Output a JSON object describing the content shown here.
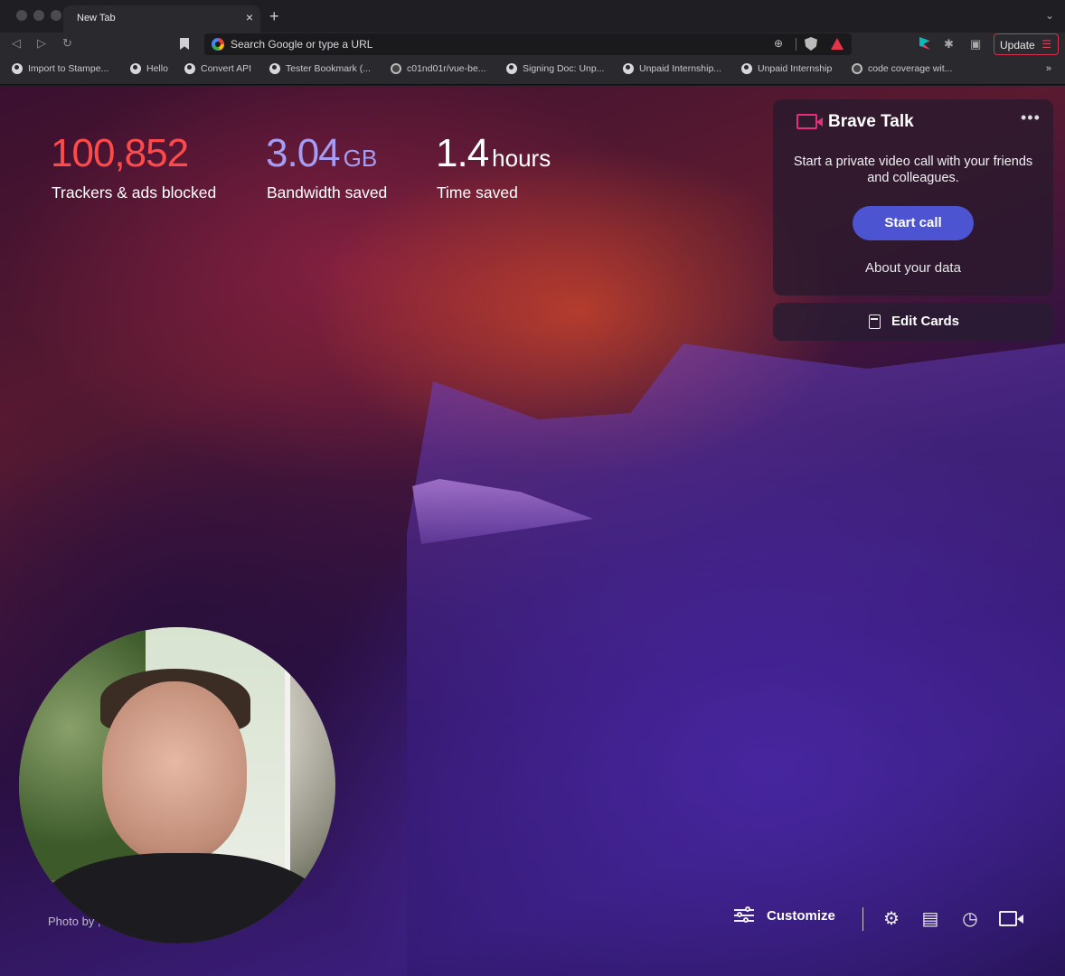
{
  "browser": {
    "tab_title": "New Tab",
    "tab_close": "×",
    "new_tab": "+",
    "tab_menu": "⌄",
    "url_placeholder": "Search Google or type a URL",
    "update_label": "Update",
    "bookmarks": [
      {
        "label": "Import to Stampe...",
        "icon": "globe-icon"
      },
      {
        "label": "Hello",
        "icon": "globe-icon"
      },
      {
        "label": "Convert API",
        "icon": "globe-icon"
      },
      {
        "label": "Tester Bookmark (...",
        "icon": "globe-icon"
      },
      {
        "label": "c01nd01r/vue-be...",
        "icon": "github-icon"
      },
      {
        "label": "Signing Doc: Unp...",
        "icon": "globe-icon"
      },
      {
        "label": "Unpaid Internship...",
        "icon": "globe-icon"
      },
      {
        "label": "Unpaid Internship",
        "icon": "globe-icon"
      },
      {
        "label": "code coverage wit...",
        "icon": "github-icon"
      }
    ],
    "bookmarks_more": "»"
  },
  "stats": {
    "trackers": {
      "value": "100,852",
      "label": "Trackers & ads blocked",
      "color": "#ff4a4a"
    },
    "bandwidth": {
      "value": "3.04",
      "unit": "GB",
      "label": "Bandwidth saved",
      "color": "#a59df5"
    },
    "time": {
      "value": "1.4",
      "unit": "hours",
      "label": "Time saved",
      "color": "#ffffff"
    }
  },
  "brave_talk": {
    "title": "Brave Talk",
    "more": "•••",
    "description": "Start a private video call with your friends and colleagues.",
    "start_button": "Start call",
    "about_link": "About your data",
    "accent": "#e3307a",
    "button_color": "#4c54d2"
  },
  "edit_cards": {
    "label": "Edit Cards"
  },
  "photo_credit": "Photo by ,",
  "footer": {
    "customize_label": "Customize",
    "settings_icon": "⚙",
    "bookmarks_icon": "▤",
    "history_icon": "◷"
  }
}
